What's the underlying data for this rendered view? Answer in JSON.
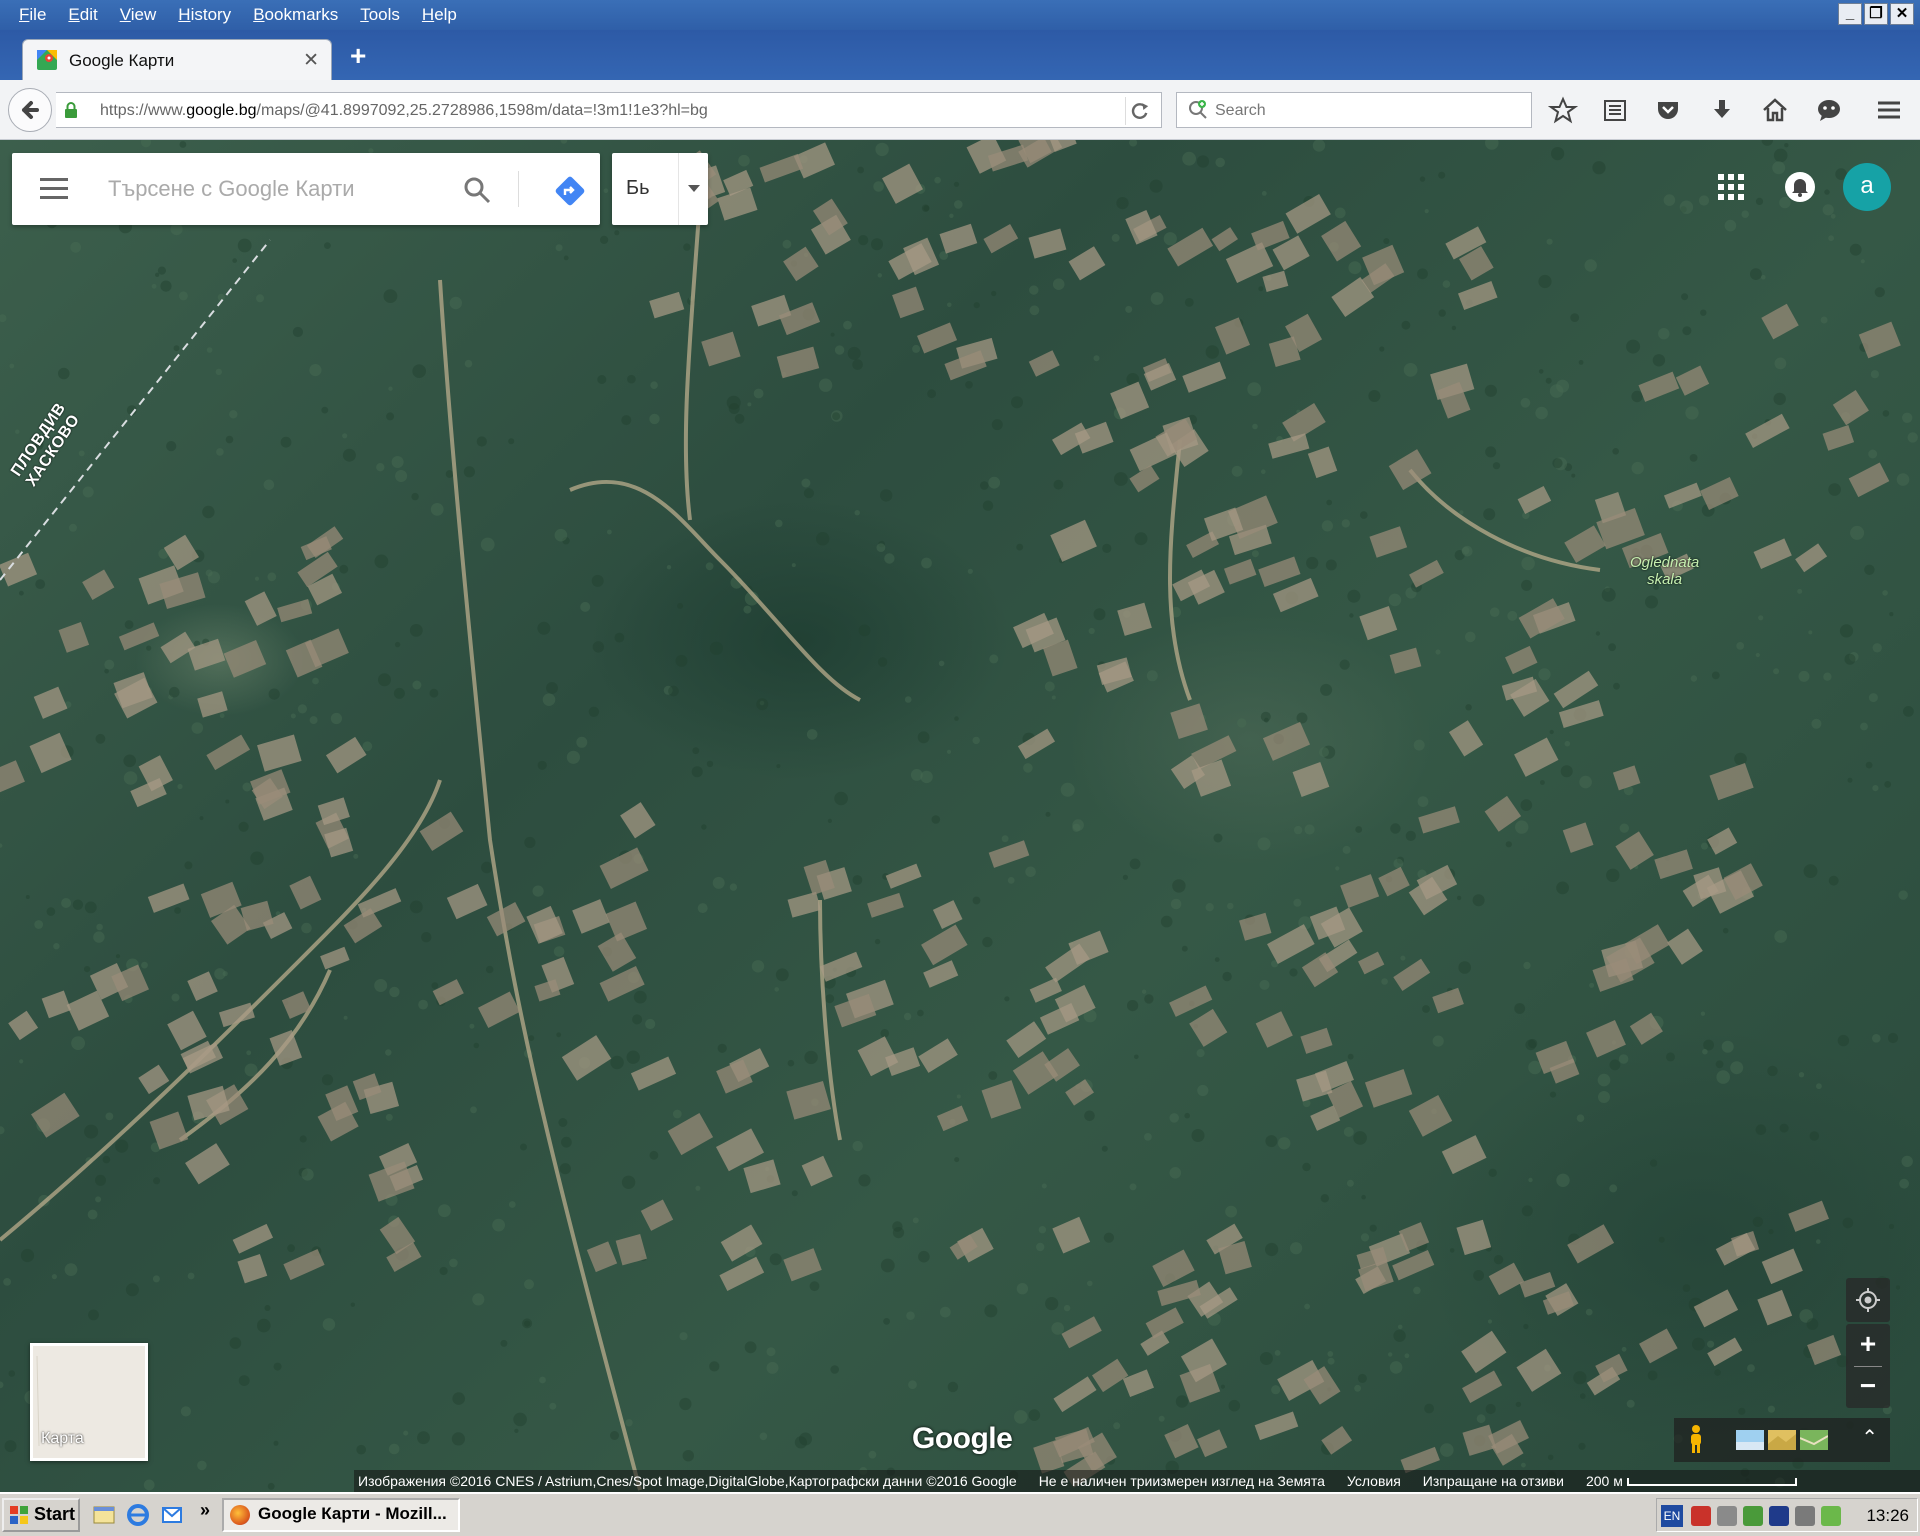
{
  "menu": {
    "items": [
      "File",
      "Edit",
      "View",
      "History",
      "Bookmarks",
      "Tools",
      "Help"
    ]
  },
  "window_controls": {
    "minimize": "_",
    "restore": "❐",
    "close": "✕"
  },
  "tab": {
    "title": "Google Карти",
    "close": "✕",
    "new_tab": "+"
  },
  "nav": {
    "url_prefix": "https://www.",
    "url_domain": "google.bg",
    "url_rest": "/maps/@41.8997092,25.2728986,1598m/data=!3m1!1e3?hl=bg",
    "search_placeholder": "Search"
  },
  "maps": {
    "search_placeholder": "Търсене с Google Карти",
    "language_label": "Бь",
    "avatar_letter": "a",
    "road_label_line1": "ПЛОВДИВ",
    "road_label_line2": "ХАСКОВО",
    "place_label_line1": "Oglednata",
    "place_label_line2": "skala",
    "minimap_label": "Карта",
    "logo": "Google",
    "zoom_in": "+",
    "zoom_out": "−",
    "expand": "⌃"
  },
  "attribution": {
    "imagery": "Изображения ©2016 CNES / Astrium,Cnes/Spot Image,DigitalGlobe,Картографски данни ©2016 Google",
    "no_3d": "Не е наличен триизмерен изглед на Земята",
    "terms": "Условия",
    "feedback": "Изпращане на отзиви",
    "scale": "200 м"
  },
  "taskbar": {
    "start": "Start",
    "more": "»",
    "task_title": "Google Карти - Mozill...",
    "lang": "EN",
    "clock": "13:26"
  },
  "colors": {
    "titlebar": "#2f5fa8",
    "avatar": "#16a2a6",
    "directions": "#4285f4",
    "forest": "#2d4d3f"
  }
}
